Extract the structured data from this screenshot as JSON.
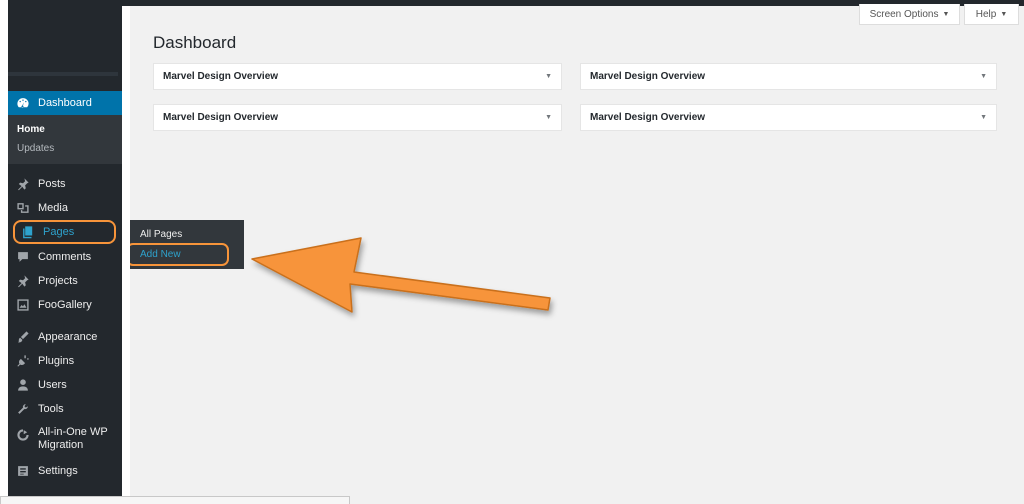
{
  "sidebar": {
    "site_name": "",
    "dashboard": {
      "label": "Dashboard",
      "icon": "dashboard-icon"
    },
    "submenu": {
      "home": "Home",
      "updates": "Updates"
    },
    "items": [
      {
        "label": "Posts",
        "icon": "pin-icon"
      },
      {
        "label": "Media",
        "icon": "media-icon"
      },
      {
        "label": "Pages",
        "icon": "pages-icon"
      },
      {
        "label": "Comments",
        "icon": "comment-icon"
      },
      {
        "label": "Projects",
        "icon": "pin-icon"
      },
      {
        "label": "FooGallery",
        "icon": "gallery-icon"
      },
      {
        "label": "Appearance",
        "icon": "brush-icon"
      },
      {
        "label": "Plugins",
        "icon": "plugin-icon"
      },
      {
        "label": "Users",
        "icon": "user-icon"
      },
      {
        "label": "Tools",
        "icon": "wrench-icon"
      },
      {
        "label": "All-in-One WP",
        "label2": "Migration",
        "icon": "migration-icon"
      },
      {
        "label": "Settings",
        "icon": "settings-icon"
      }
    ]
  },
  "flyout": {
    "all_pages": "All Pages",
    "add_new": "Add New"
  },
  "header": {
    "screen_options": "Screen Options",
    "help": "Help",
    "caret": "▼"
  },
  "page": {
    "title": "Dashboard"
  },
  "widgets": [
    {
      "title": "Marvel Design Overview",
      "toggle": "▼"
    },
    {
      "title": "Marvel Design Overview",
      "toggle": "▼"
    },
    {
      "title": "Marvel Design Overview",
      "toggle": "▼"
    },
    {
      "title": "Marvel Design Overview",
      "toggle": "▼"
    }
  ],
  "status_bar": {
    "text": ""
  },
  "colors": {
    "highlight": "#f7943a",
    "accent": "#0073aa",
    "link": "#2ea2cc",
    "sidebar": "#23282d"
  }
}
